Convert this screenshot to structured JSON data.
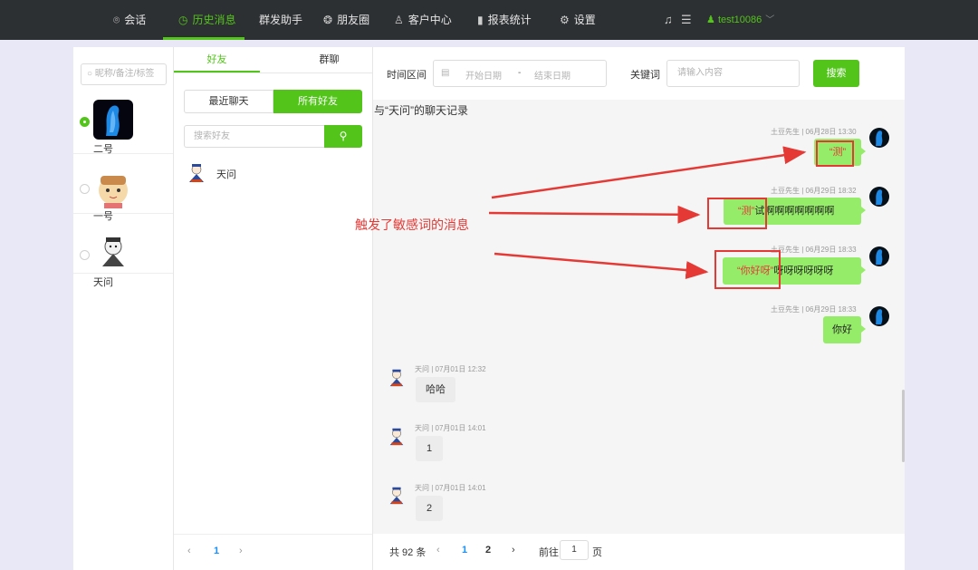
{
  "nav": {
    "items": [
      {
        "label": "会话",
        "icon": "chat-icon"
      },
      {
        "label": "历史消息",
        "icon": "clock-icon"
      },
      {
        "label": "群发助手",
        "icon": ""
      },
      {
        "label": "朋友圈",
        "icon": "moments-icon"
      },
      {
        "label": "客户中心",
        "icon": "user-icon"
      },
      {
        "label": "报表统计",
        "icon": "bar-chart-icon"
      },
      {
        "label": "设置",
        "icon": "gear-icon"
      }
    ],
    "active_index": 1,
    "username": "test10086",
    "accent_color": "#52c41a",
    "bg_color": "#2d3033"
  },
  "accounts": {
    "search_placeholder": "昵称/备注/标签",
    "items": [
      {
        "name": "二号",
        "selected": true
      },
      {
        "name": "一号",
        "selected": false
      },
      {
        "name": "天问",
        "selected": false
      }
    ]
  },
  "friends": {
    "tabs": [
      "好友",
      "群聊"
    ],
    "segments": [
      "最近聊天",
      "所有好友"
    ],
    "search_placeholder": "搜索好友",
    "list": [
      {
        "name": "天问"
      }
    ],
    "pager": {
      "current": "1"
    }
  },
  "filter": {
    "time_label": "时间区间",
    "start_placeholder": "开始日期",
    "separator": "-",
    "end_placeholder": "结束日期",
    "keyword_label": "关键词",
    "keyword_placeholder": "请输入内容",
    "search_label": "搜索"
  },
  "chat": {
    "title": "与“天问”的聊天记录",
    "messages": [
      {
        "side": "right",
        "meta": "土豆先生 | 06月28日 13:30",
        "highlight": "“测”",
        "rest": ""
      },
      {
        "side": "right",
        "meta": "土豆先生 | 06月29日 18:32",
        "highlight": "“测”",
        "rest": "试啊啊啊啊啊啊啊"
      },
      {
        "side": "right",
        "meta": "土豆先生 | 06月29日 18:33",
        "highlight": "“你好呀”",
        "rest": "呀呀呀呀呀呀"
      },
      {
        "side": "right",
        "meta": "土豆先生 | 06月29日 18:33",
        "highlight": "",
        "rest": "你好"
      },
      {
        "side": "left",
        "meta": "天问 | 07月01日 12:32",
        "highlight": "",
        "rest": "哈哈"
      },
      {
        "side": "left",
        "meta": "天问 | 07月01日 14:01",
        "highlight": "",
        "rest": "1"
      },
      {
        "side": "left",
        "meta": "天问 | 07月01日 14:01",
        "highlight": "",
        "rest": "2"
      }
    ]
  },
  "pager": {
    "total": "共 92 条",
    "pages": [
      "1",
      "2"
    ],
    "current": "1",
    "goto_label": "前往",
    "goto_value": "1",
    "page_unit": "页"
  },
  "annotation": {
    "text": "触发了敏感词的消息",
    "color": "#e53935"
  }
}
